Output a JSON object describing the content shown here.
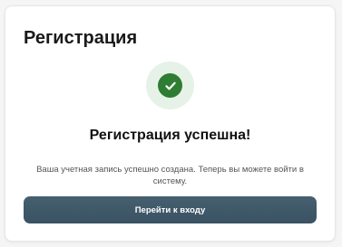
{
  "card": {
    "title": "Регистрация"
  },
  "status": {
    "icon": "check-circle-icon",
    "heading": "Регистрация успешна!",
    "message": "Ваша учетная запись успешно создана. Теперь вы можете войти в систему."
  },
  "actions": {
    "login_label": "Перейти к входу"
  },
  "colors": {
    "success": "#2e7d32",
    "success_bg": "#e6f2e8",
    "button_bg": "#3f5868",
    "text_primary": "#111111",
    "text_secondary": "#555555"
  }
}
